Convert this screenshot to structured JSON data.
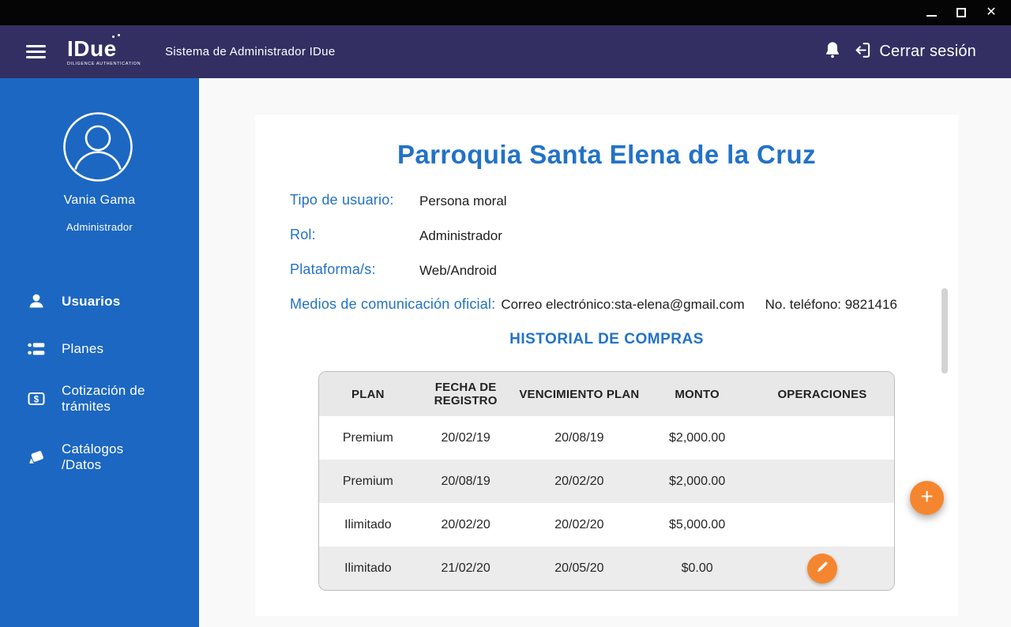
{
  "window": {
    "controls": {
      "close_glyph": "✕"
    }
  },
  "header": {
    "logo": {
      "text": "IDue",
      "subtitle": "DILIGENCE AUTHENTICATION"
    },
    "app_title": "Sistema de Administrador IDue",
    "logout_label": "Cerrar sesión"
  },
  "sidebar": {
    "user": {
      "name": "Vania Gama",
      "role": "Administrador"
    },
    "nav": [
      {
        "label": "Usuarios",
        "icon": "users-icon",
        "active": true
      },
      {
        "label": "Planes",
        "icon": "plans-icon",
        "active": false
      },
      {
        "label": "Cotización de trámites",
        "icon": "quote-icon",
        "active": false
      },
      {
        "label": "Catálogos /Datos",
        "icon": "catalogs-icon",
        "active": false
      }
    ]
  },
  "main": {
    "title": "Parroquia Santa Elena de la Cruz",
    "details": [
      {
        "label": "Tipo de usuario:",
        "value": "Persona moral"
      },
      {
        "label": "Rol:",
        "value": "Administrador"
      },
      {
        "label": "Plataforma/s:",
        "value": "Web/Android"
      },
      {
        "label": "Medios de comunicación oficial:",
        "value": "Correo electrónico:sta-elena@gmail.com",
        "value2": "No. teléfono: 9821416"
      }
    ],
    "section_title": "HISTORIAL DE COMPRAS",
    "table": {
      "columns": [
        "PLAN",
        "FECHA DE REGISTRO",
        "VENCIMIENTO PLAN",
        "MONTO",
        "OPERACIONES"
      ],
      "rows": [
        {
          "plan": "Premium",
          "registro": "20/02/19",
          "vencimiento": "20/08/19",
          "monto": "$2,000.00"
        },
        {
          "plan": "Premium",
          "registro": "20/08/19",
          "vencimiento": "20/02/20",
          "monto": "$2,000.00"
        },
        {
          "plan": "Ilimitado",
          "registro": "20/02/20",
          "vencimiento": "20/02/20",
          "monto": "$5,000.00"
        },
        {
          "plan": "Ilimitado",
          "registro": "21/02/20",
          "vencimiento": "20/05/20",
          "monto": "$0.00"
        }
      ]
    },
    "fab_label": "+"
  },
  "colors": {
    "header_navy": "#332f63",
    "sidebar_blue": "#1c67c2",
    "accent_blue": "#2272c8",
    "orange": "#f5862f"
  }
}
